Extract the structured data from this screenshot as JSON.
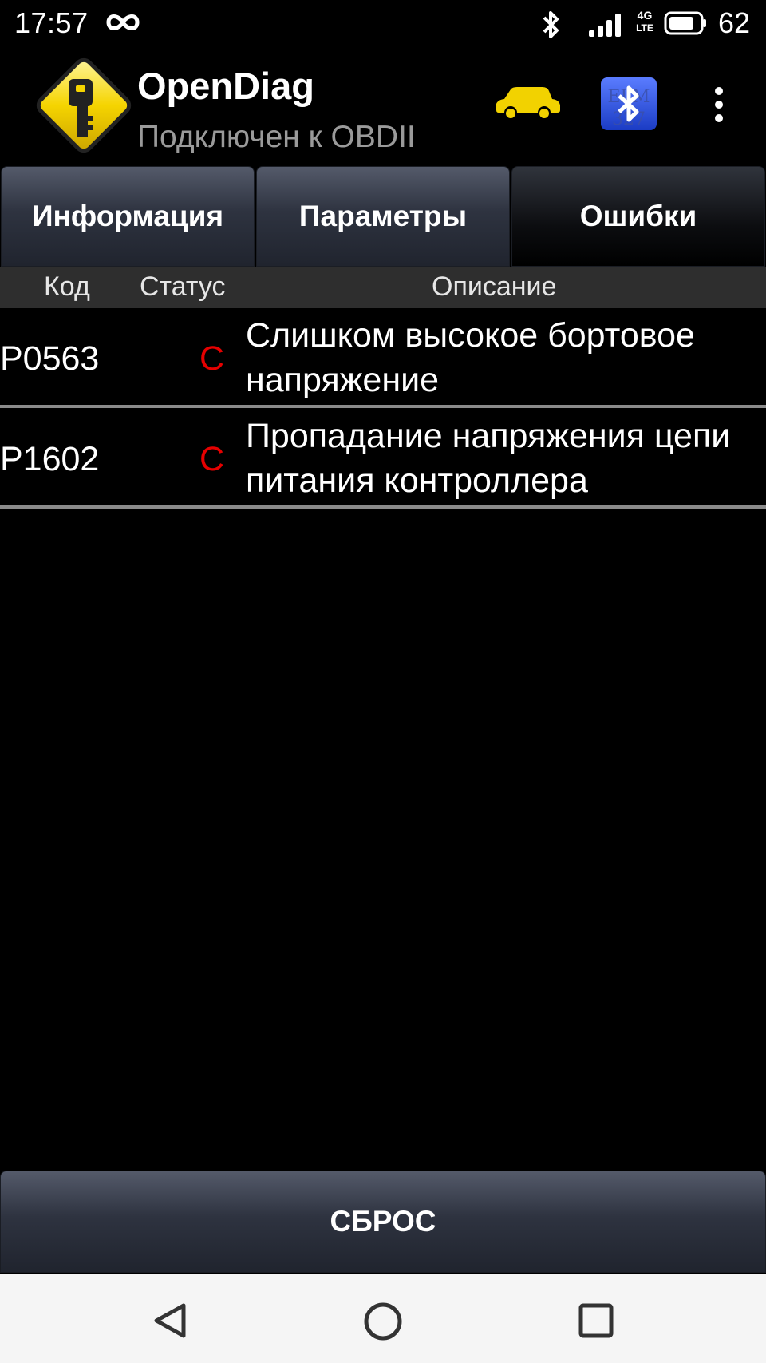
{
  "status_bar": {
    "time": "17:57",
    "network_label": "4G\nLTE",
    "battery": "62",
    "icons": [
      "infinity-icon",
      "bluetooth-icon",
      "signal-icon",
      "battery-icon"
    ]
  },
  "app_bar": {
    "title": "OpenDiag",
    "subtitle": "Подключен к OBDII",
    "icons": [
      "app-logo-key",
      "car-icon",
      "elm327-bluetooth-icon",
      "more-vert-icon"
    ],
    "colors": {
      "car": "#f2d200",
      "logo": "#f5d400"
    }
  },
  "tabs": [
    {
      "label": "Информация",
      "active": false
    },
    {
      "label": "Параметры",
      "active": false
    },
    {
      "label": "Ошибки",
      "active": true
    }
  ],
  "errors_table": {
    "headers": {
      "code": "Код",
      "status": "Статус",
      "description": "Описание"
    },
    "rows": [
      {
        "code": "P0563",
        "status": "C",
        "description": "Слишком высокое бортовое напряжение"
      },
      {
        "code": "P1602",
        "status": "C",
        "description": "Пропадание напряжения цепи питания контроллера"
      }
    ],
    "status_color": "#e60000"
  },
  "reset_button": {
    "label": "СБРОС"
  },
  "nav_bar": {
    "icons": [
      "back-icon",
      "home-icon",
      "recent-apps-icon"
    ]
  }
}
